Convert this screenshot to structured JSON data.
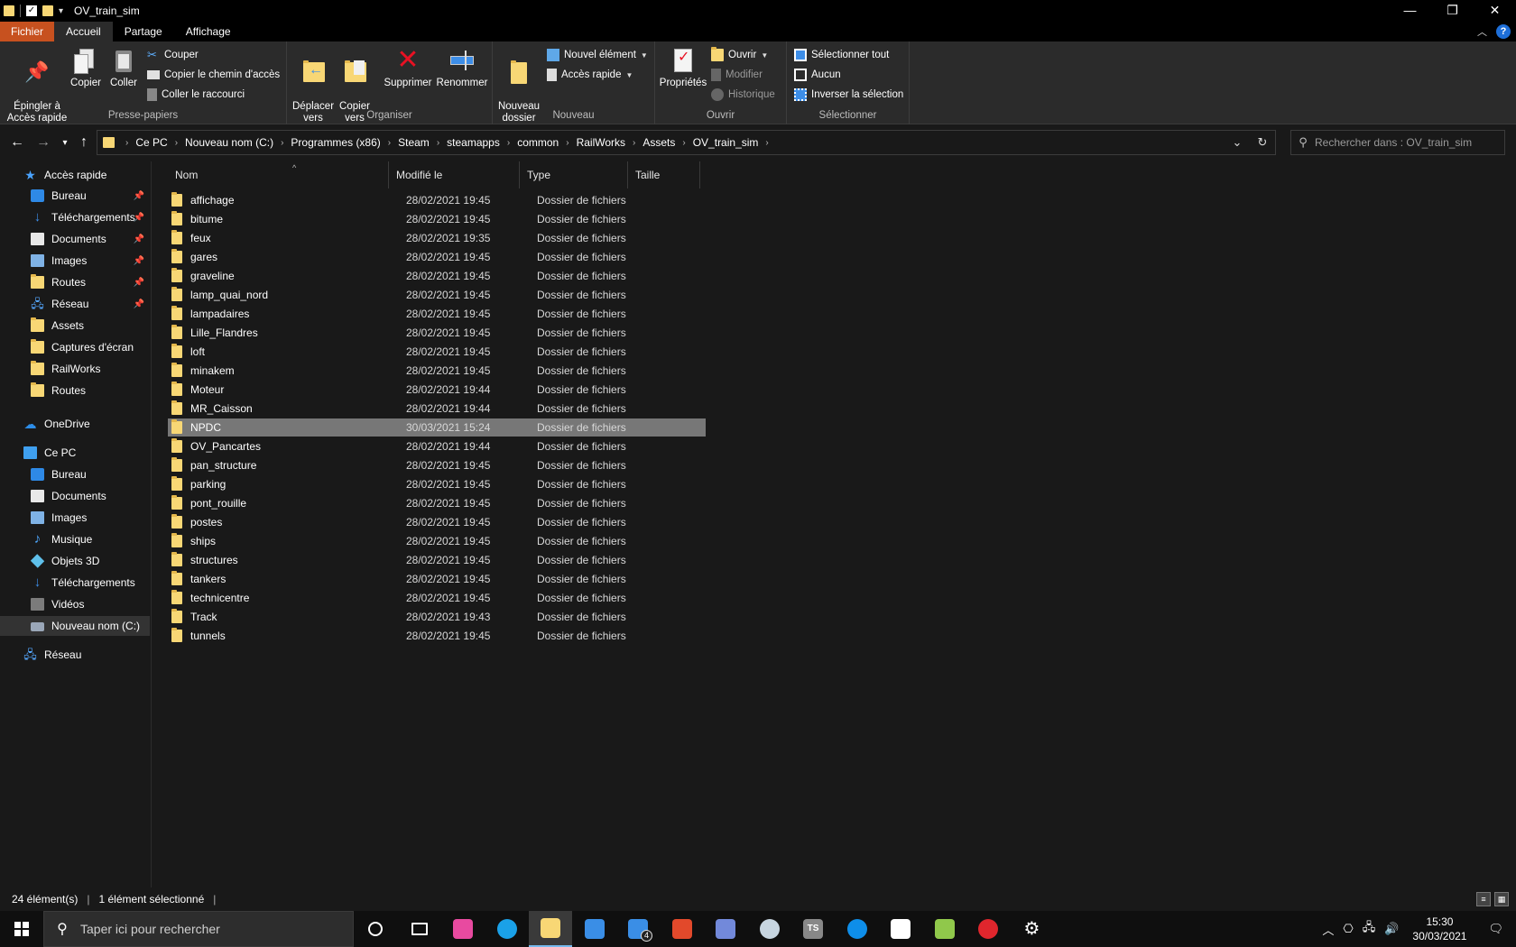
{
  "window": {
    "title": "OV_train_sim"
  },
  "tabs": [
    "Fichier",
    "Accueil",
    "Partage",
    "Affichage"
  ],
  "ribbon": {
    "presse_papiers": {
      "label": "Presse-papiers",
      "pin": "Épingler à\nAccès rapide",
      "copy": "Copier",
      "paste": "Coller",
      "cut": "Couper",
      "copy_path": "Copier le chemin d'accès",
      "paste_shortcut": "Coller le raccourci"
    },
    "organiser": {
      "label": "Organiser",
      "move_to": "Déplacer\nvers",
      "copy_to": "Copier\nvers",
      "delete": "Supprimer",
      "rename": "Renommer"
    },
    "nouveau": {
      "label": "Nouveau",
      "new_folder": "Nouveau\ndossier",
      "new_item": "Nouvel élément",
      "easy_access": "Accès rapide"
    },
    "ouvrir": {
      "label": "Ouvrir",
      "properties": "Propriétés",
      "open": "Ouvrir",
      "edit": "Modifier",
      "history": "Historique"
    },
    "selectionner": {
      "label": "Sélectionner",
      "select_all": "Sélectionner tout",
      "select_none": "Aucun",
      "invert": "Inverser la sélection"
    }
  },
  "address": {
    "crumbs": [
      "Ce PC",
      "Nouveau nom (C:)",
      "Programmes (x86)",
      "Steam",
      "steamapps",
      "common",
      "RailWorks",
      "Assets",
      "OV_train_sim"
    ],
    "search_placeholder": "Rechercher dans : OV_train_sim"
  },
  "nav": {
    "quick_access": "Accès rapide",
    "quick_items": [
      {
        "label": "Bureau",
        "icon": "desktop-icon",
        "pinned": true
      },
      {
        "label": "Téléchargements",
        "icon": "download-icon",
        "pinned": true
      },
      {
        "label": "Documents",
        "icon": "documents-icon",
        "pinned": true
      },
      {
        "label": "Images",
        "icon": "pictures-icon",
        "pinned": true
      },
      {
        "label": "Routes",
        "icon": "folder-icon",
        "pinned": true
      },
      {
        "label": "Réseau",
        "icon": "network-icon",
        "pinned": true
      },
      {
        "label": "Assets",
        "icon": "folder-icon",
        "pinned": false
      },
      {
        "label": "Captures d'écran",
        "icon": "folder-icon",
        "pinned": false
      },
      {
        "label": "RailWorks",
        "icon": "folder-icon",
        "pinned": false
      },
      {
        "label": "Routes",
        "icon": "folder-icon",
        "pinned": false
      }
    ],
    "onedrive": "OneDrive",
    "this_pc": "Ce PC",
    "pc_items": [
      {
        "label": "Bureau",
        "icon": "desktop-icon"
      },
      {
        "label": "Documents",
        "icon": "documents-icon"
      },
      {
        "label": "Images",
        "icon": "pictures-icon"
      },
      {
        "label": "Musique",
        "icon": "music-icon"
      },
      {
        "label": "Objets 3D",
        "icon": "3d-objects-icon"
      },
      {
        "label": "Téléchargements",
        "icon": "download-icon"
      },
      {
        "label": "Vidéos",
        "icon": "videos-icon"
      },
      {
        "label": "Nouveau nom (C:)",
        "icon": "drive-icon",
        "selected": true
      }
    ],
    "network": "Réseau"
  },
  "columns": [
    "Nom",
    "Modifié le",
    "Type",
    "Taille"
  ],
  "files": [
    {
      "name": "affichage",
      "date": "28/02/2021 19:45",
      "type": "Dossier de fichiers"
    },
    {
      "name": "bitume",
      "date": "28/02/2021 19:45",
      "type": "Dossier de fichiers"
    },
    {
      "name": "feux",
      "date": "28/02/2021 19:35",
      "type": "Dossier de fichiers"
    },
    {
      "name": "gares",
      "date": "28/02/2021 19:45",
      "type": "Dossier de fichiers"
    },
    {
      "name": "graveline",
      "date": "28/02/2021 19:45",
      "type": "Dossier de fichiers"
    },
    {
      "name": "lamp_quai_nord",
      "date": "28/02/2021 19:45",
      "type": "Dossier de fichiers"
    },
    {
      "name": "lampadaires",
      "date": "28/02/2021 19:45",
      "type": "Dossier de fichiers"
    },
    {
      "name": "Lille_Flandres",
      "date": "28/02/2021 19:45",
      "type": "Dossier de fichiers"
    },
    {
      "name": "loft",
      "date": "28/02/2021 19:45",
      "type": "Dossier de fichiers"
    },
    {
      "name": "minakem",
      "date": "28/02/2021 19:45",
      "type": "Dossier de fichiers"
    },
    {
      "name": "Moteur",
      "date": "28/02/2021 19:44",
      "type": "Dossier de fichiers"
    },
    {
      "name": "MR_Caisson",
      "date": "28/02/2021 19:44",
      "type": "Dossier de fichiers"
    },
    {
      "name": "NPDC",
      "date": "30/03/2021 15:24",
      "type": "Dossier de fichiers",
      "selected": true
    },
    {
      "name": "OV_Pancartes",
      "date": "28/02/2021 19:44",
      "type": "Dossier de fichiers"
    },
    {
      "name": "pan_structure",
      "date": "28/02/2021 19:45",
      "type": "Dossier de fichiers"
    },
    {
      "name": "parking",
      "date": "28/02/2021 19:45",
      "type": "Dossier de fichiers"
    },
    {
      "name": "pont_rouille",
      "date": "28/02/2021 19:45",
      "type": "Dossier de fichiers"
    },
    {
      "name": "postes",
      "date": "28/02/2021 19:45",
      "type": "Dossier de fichiers"
    },
    {
      "name": "ships",
      "date": "28/02/2021 19:45",
      "type": "Dossier de fichiers"
    },
    {
      "name": "structures",
      "date": "28/02/2021 19:45",
      "type": "Dossier de fichiers"
    },
    {
      "name": "tankers",
      "date": "28/02/2021 19:45",
      "type": "Dossier de fichiers"
    },
    {
      "name": "technicentre",
      "date": "28/02/2021 19:45",
      "type": "Dossier de fichiers"
    },
    {
      "name": "Track",
      "date": "28/02/2021 19:43",
      "type": "Dossier de fichiers"
    },
    {
      "name": "tunnels",
      "date": "28/02/2021 19:45",
      "type": "Dossier de fichiers"
    }
  ],
  "status": {
    "count": "24 élément(s)",
    "selection": "1 élément sélectionné"
  },
  "taskbar": {
    "search_placeholder": "Taper ici pour rechercher",
    "mail_badge": "4",
    "ts_label": "TS",
    "time": "15:30",
    "date": "30/03/2021",
    "apps": [
      {
        "name": "cortana-icon",
        "color": "#ffffff"
      },
      {
        "name": "task-view-icon",
        "color": "#ffffff"
      },
      {
        "name": "paint3d-icon",
        "color": "#e84aa0"
      },
      {
        "name": "edge-icon",
        "color": "#1aa1e8"
      },
      {
        "name": "file-explorer-icon",
        "color": "#f8d775"
      },
      {
        "name": "store-icon",
        "color": "#3a8ee6"
      },
      {
        "name": "mail-icon",
        "color": "#3a8ee6"
      },
      {
        "name": "office-icon",
        "color": "#e2492b"
      },
      {
        "name": "discord-icon",
        "color": "#7289da"
      },
      {
        "name": "steam-icon",
        "color": "#c7d5e0"
      },
      {
        "name": "ts-icon",
        "color": "#888888"
      },
      {
        "name": "teamviewer-icon",
        "color": "#0e8ee9"
      },
      {
        "name": "notepad-icon",
        "color": "#ffffff"
      },
      {
        "name": "notepadpp-icon",
        "color": "#90c84b"
      },
      {
        "name": "opera-icon",
        "color": "#e0262d"
      },
      {
        "name": "settings-icon",
        "color": "#ffffff"
      }
    ]
  },
  "colors": {
    "file_tab": "#c7511f",
    "selection": "#777777",
    "folder": "#f8d775",
    "accent": "#1e6fd9"
  }
}
